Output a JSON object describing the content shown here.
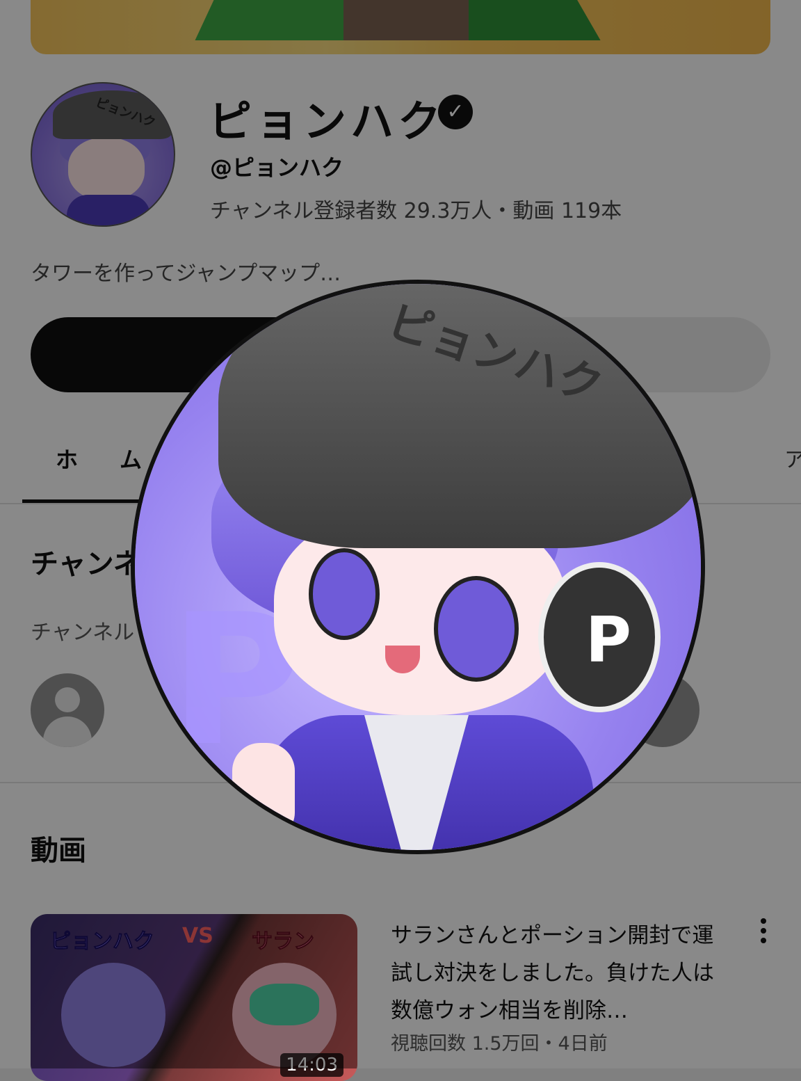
{
  "channel": {
    "name": "ピョンハク",
    "handle": "@ピョンハク",
    "stats": "チャンネル登録者数 29.3万人・動画 119本",
    "description": "タワーを作ってジャンプマップ…",
    "verified_icon": "verified-check-icon",
    "cap_text": "ピョンハク",
    "avatar_letter": "P"
  },
  "tabs": {
    "home": "ホム",
    "edge": "ア"
  },
  "sections": {
    "channels_title": "チャンネ",
    "channels_sub": "チャンネル",
    "videos_title": "動画"
  },
  "video": {
    "title": "サランさんとポーション開封で運試し対決をしました。負けた人は数億ウォン相当を削除…",
    "meta": "視聴回数 1.5万回・4日前",
    "duration": "14:03",
    "thumb_left": "ピョンハク",
    "thumb_vs": "VS",
    "thumb_right": "サラン"
  },
  "colors": {
    "overlay": "#000000",
    "accent_purple": "#7b64e0"
  }
}
